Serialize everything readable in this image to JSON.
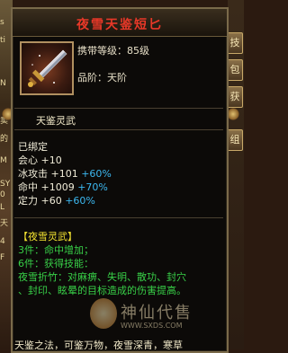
{
  "tooltip": {
    "title": "夜雪天鉴短匕",
    "carry_level": "携带等级：85级",
    "grade": "品阶：天阶",
    "section": "天鉴灵武",
    "bound": "已绑定",
    "stats": [
      {
        "label": "会心 +10",
        "bonus": ""
      },
      {
        "label": "冰攻击 +101",
        "bonus": "+60%"
      },
      {
        "label": "命中 +1009",
        "bonus": "+70%"
      },
      {
        "label": "定力 +60",
        "bonus": "+60%"
      }
    ],
    "set": {
      "name": "【夜雪灵武】",
      "piece3": "3件：命中增加；",
      "piece6": "6件：获得技能：",
      "skill_line1": "夜雪折竹：对麻痹、失明、散功、封穴",
      "skill_line2": "、封印、眩晕的目标造成的伤害提高。"
    },
    "bottom_text": "天鉴之法，可鉴万物，夜雪深青，寒草"
  },
  "side_buttons": [
    "技",
    "包",
    "获",
    "组"
  ],
  "left_fragments": [
    "s",
    "ti",
    "N",
    "卖",
    "的",
    "M",
    "SY",
    "0",
    "L",
    "天",
    "4",
    "F"
  ],
  "watermark": {
    "title": "神仙代售",
    "url": "WWW.SXDS.COM"
  },
  "colors": {
    "title": "#e83828",
    "stat_white": "#f0ecd8",
    "stat_blue": "#3cb8f0",
    "set_yellow": "#f0e030",
    "set_green": "#38d048"
  }
}
